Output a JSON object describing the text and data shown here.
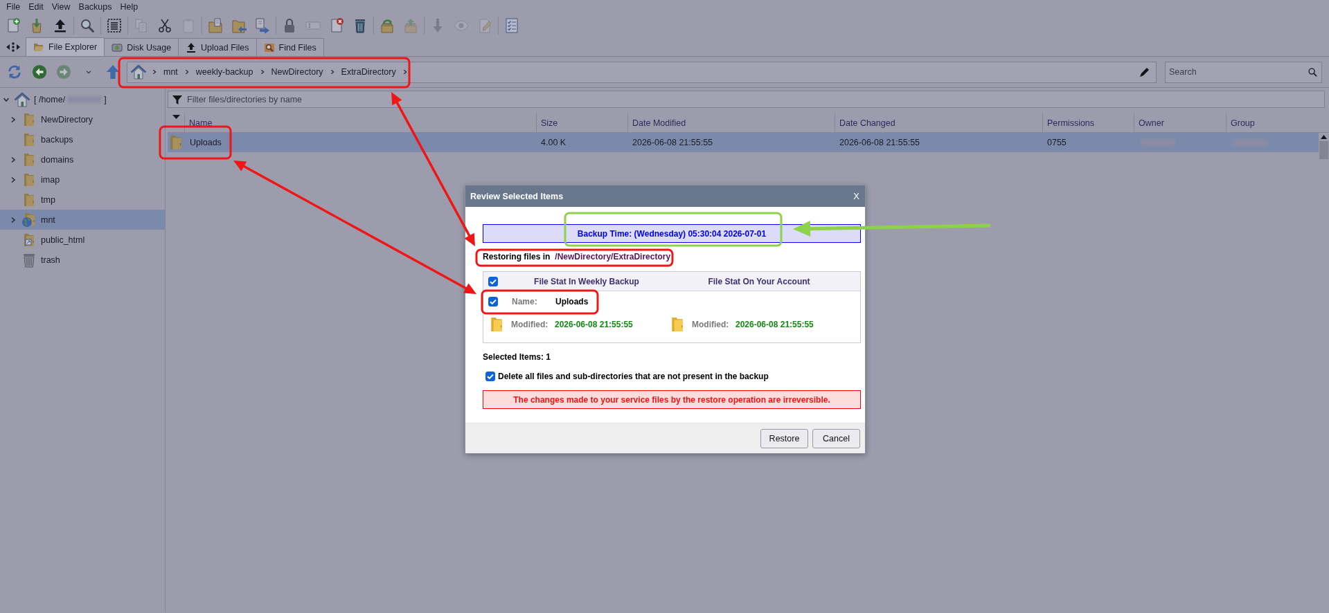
{
  "menu_bar": [
    "File",
    "Edit",
    "View",
    "Backups",
    "Help"
  ],
  "toolbar": [
    [
      {
        "kind": "new-file",
        "disabled": false
      },
      {
        "kind": "extract",
        "disabled": false
      },
      {
        "kind": "upload",
        "disabled": false
      }
    ],
    [
      {
        "kind": "search",
        "disabled": false
      }
    ],
    [
      {
        "kind": "select-all",
        "disabled": false
      }
    ],
    [
      {
        "kind": "copy",
        "disabled": true
      },
      {
        "kind": "cut",
        "disabled": false
      },
      {
        "kind": "paste",
        "disabled": true
      }
    ],
    [
      {
        "kind": "folder-file",
        "disabled": false
      },
      {
        "kind": "folder-move",
        "disabled": false
      },
      {
        "kind": "move",
        "disabled": false
      }
    ],
    [
      {
        "kind": "permissions",
        "disabled": false
      },
      {
        "kind": "rename",
        "disabled": true
      },
      {
        "kind": "delete-file",
        "disabled": false
      },
      {
        "kind": "trash",
        "disabled": false
      }
    ],
    [
      {
        "kind": "restore",
        "disabled": false
      },
      {
        "kind": "compress",
        "disabled": true
      }
    ],
    [
      {
        "kind": "download",
        "disabled": true
      },
      {
        "kind": "view",
        "disabled": true
      },
      {
        "kind": "edit",
        "disabled": true
      }
    ],
    [
      {
        "kind": "checklist",
        "disabled": false
      }
    ]
  ],
  "tabs": [
    {
      "label": "File Explorer",
      "kind": "explorer",
      "selected": true
    },
    {
      "label": "Disk Usage",
      "kind": "disk",
      "selected": false
    },
    {
      "label": "Upload Files",
      "kind": "upload",
      "selected": false
    },
    {
      "label": "Find Files",
      "kind": "search",
      "selected": false
    }
  ],
  "navigation": [
    {
      "kind": "refresh",
      "disabled": false
    },
    {
      "kind": "back",
      "disabled": false
    },
    {
      "kind": "forward",
      "disabled": true
    },
    {
      "kind": "history",
      "disabled": false
    },
    {
      "kind": "up",
      "disabled": false
    }
  ],
  "breadcrumb": [
    "mnt",
    "weekly-backup",
    "NewDirectory",
    "ExtraDirectory"
  ],
  "search": {
    "placeholder": "Search"
  },
  "sidebar": {
    "tree": [
      {
        "label": "[ /home/",
        "label_end": "]",
        "redacted": true,
        "kind": "home",
        "expanded": true,
        "selected": false,
        "children": [
          {
            "label": "NewDirectory",
            "kind": "folder",
            "expanded": false,
            "selected": false
          },
          {
            "label": "backups",
            "kind": "folder",
            "selected": false
          },
          {
            "label": "domains",
            "kind": "folder",
            "expanded": false,
            "selected": false
          },
          {
            "label": "imap",
            "kind": "folder",
            "expanded": false,
            "selected": false
          },
          {
            "label": "tmp",
            "kind": "folder",
            "selected": false
          },
          {
            "label": "mnt",
            "kind": "mount",
            "expanded": false,
            "selected": true
          },
          {
            "label": "public_html",
            "kind": "link",
            "selected": false
          },
          {
            "label": "trash",
            "kind": "trash",
            "selected": false
          }
        ]
      }
    ]
  },
  "filter": {
    "placeholder": "Filter files/directories by name"
  },
  "table": {
    "columns": [
      "Name",
      "Size",
      "Date Modified",
      "Date Changed",
      "Permissions",
      "Owner",
      "Group"
    ],
    "rows": [
      {
        "selected": true,
        "name": "Uploads",
        "size": "4.00 K",
        "date_modified": "2026-06-08 21:55:55",
        "date_changed": "2026-06-08 21:55:55",
        "permissions": "0755",
        "owner_redacted": true,
        "group_redacted": true
      }
    ]
  },
  "dialog": {
    "title": "Review Selected Items",
    "close_label": "X",
    "backup_time": "Backup Time: (Wednesday) 05:30:04 2026-07-01",
    "restoring_label": "Restoring files in",
    "restoring_path": "/NewDirectory/ExtraDirectory",
    "table": {
      "all_checked": true,
      "columns": [
        "File Stat In Weekly Backup",
        "File Stat On Your Account"
      ],
      "items": [
        {
          "checked": true,
          "name_label": "Name:",
          "name": "Uploads",
          "stats": [
            {
              "label": "Modified:",
              "value": "2026-06-08 21:55:55"
            },
            {
              "label": "Modified:",
              "value": "2026-06-08 21:55:55"
            }
          ]
        }
      ]
    },
    "selected_count": "Selected Items: 1",
    "delete_option": {
      "label": "Delete all files and sub-directories that are not present in the backup",
      "checked": true
    },
    "warning": "The changes made to your service files by the restore operation are irreversible.",
    "buttons": [
      "Restore",
      "Cancel"
    ]
  },
  "annotations": [
    {
      "kind": "frame",
      "color": "#f01616"
    },
    {
      "kind": "frame",
      "color": "#f01616"
    },
    {
      "kind": "frame",
      "color": "#f01616"
    },
    {
      "kind": "frame",
      "color": "#f01616"
    },
    {
      "kind": "frame",
      "color": "#8ed14b"
    },
    {
      "kind": "double-arrow",
      "color": "#f01616"
    },
    {
      "kind": "double-arrow",
      "color": "#f01616"
    },
    {
      "kind": "arrow",
      "color": "#8ed14b"
    }
  ]
}
